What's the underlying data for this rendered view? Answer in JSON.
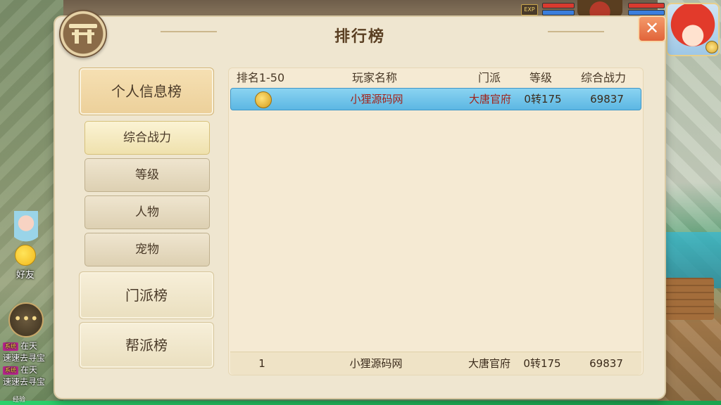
{
  "hud": {
    "exp_badge": "EXP",
    "friend_label": "好友",
    "exp_bar_label": "经验"
  },
  "chat": {
    "lines": [
      {
        "tag": "系统",
        "text": "在天"
      },
      {
        "tag": "",
        "text": "速速去寻宝"
      },
      {
        "tag": "系统",
        "text": "在天"
      },
      {
        "tag": "",
        "text": "速速去寻宝"
      }
    ]
  },
  "panel": {
    "title": "排行榜",
    "close_icon": "✕"
  },
  "sidebar": {
    "categories": [
      {
        "label": "个人信息榜",
        "active": true
      },
      {
        "label": "门派榜",
        "active": false
      },
      {
        "label": "帮派榜",
        "active": false
      }
    ],
    "subcategories": [
      {
        "label": "综合战力",
        "active": true
      },
      {
        "label": "等级",
        "active": false
      },
      {
        "label": "人物",
        "active": false
      },
      {
        "label": "宠物",
        "active": false
      }
    ]
  },
  "table": {
    "headers": {
      "rank": "排名1-50",
      "name": "玩家名称",
      "sect": "门派",
      "level": "等级",
      "power": "综合战力"
    },
    "rows": [
      {
        "rank_icon": "gold-medal-icon",
        "name": "小狸源码网",
        "sect": "大唐官府",
        "level": "0转175",
        "power": "69837"
      }
    ],
    "my_row": {
      "rank": "1",
      "name": "小狸源码网",
      "sect": "大唐官府",
      "level": "0转175",
      "power": "69837"
    }
  },
  "colors": {
    "highlight_row": "#5cb7e3",
    "player_name": "#a1231a",
    "close_button": "#e1643a"
  }
}
